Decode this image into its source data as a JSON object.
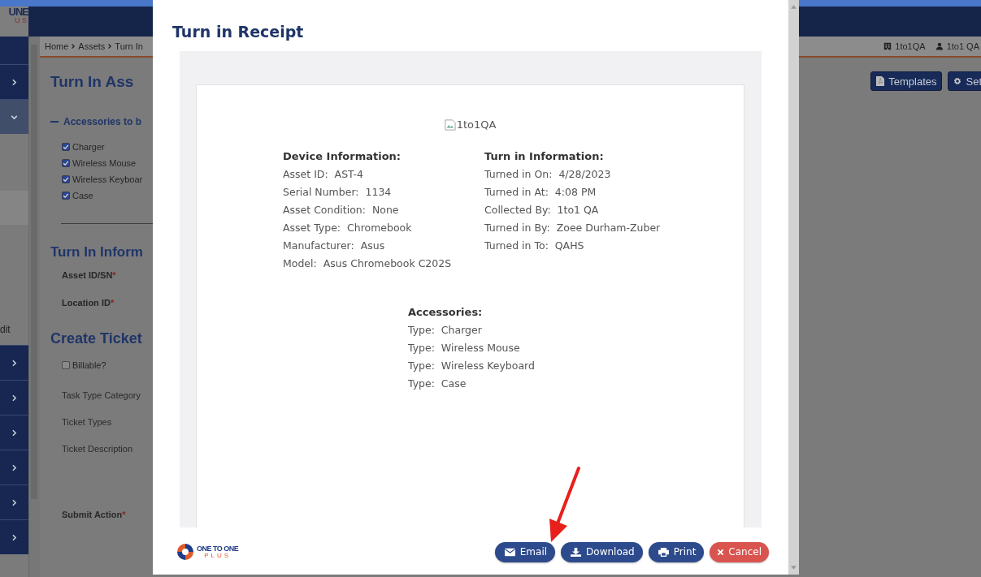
{
  "logo": {
    "text": "UNE",
    "subtext": "U S"
  },
  "sidebar": {
    "items": [
      {
        "expanded": false
      },
      {
        "expanded": true
      }
    ],
    "label": "dit",
    "lower_items": [
      {
        "expanded": false
      },
      {
        "expanded": false
      },
      {
        "expanded": false
      },
      {
        "expanded": false
      },
      {
        "expanded": false
      },
      {
        "expanded": false
      }
    ]
  },
  "breadcrumb": [
    "Home",
    "Assets",
    "Turn In"
  ],
  "account": {
    "site": "1to1QA",
    "user": "1to1 QA"
  },
  "toolbar": [
    {
      "label": "Templates",
      "kind": "templates"
    },
    {
      "label": "Set",
      "kind": "settings"
    }
  ],
  "page": {
    "title": "Turn In Ass",
    "accessories_heading": "Accessories to b",
    "accessories": [
      {
        "label": "Charger",
        "checked": true
      },
      {
        "label": "Wireless Mouse",
        "checked": true
      },
      {
        "label": "Wireless Keyboar",
        "checked": true
      },
      {
        "label": "Case",
        "checked": true
      }
    ],
    "turn_in_heading": "Turn In Inform",
    "fields": [
      {
        "label": "Asset ID/SN",
        "required_mark": "*"
      },
      {
        "label": "Location ID",
        "required_mark": "*"
      }
    ],
    "ticket_heading": "Create Ticket",
    "billable": {
      "label": "Billable?",
      "checked": false
    },
    "ticket_fields": [
      {
        "label": "Task Type Category"
      },
      {
        "label": "Ticket Types"
      },
      {
        "label": "Ticket Description"
      },
      {
        "label": "Submit Action",
        "required_mark": "*"
      }
    ]
  },
  "modal": {
    "title": "Turn in Receipt",
    "logo_alt": "1to1QA",
    "device": {
      "heading": "Device Information:",
      "rows": [
        "Asset ID:  AST-4",
        "Serial Number:  1134",
        "Asset Condition:  None",
        "Asset Type:  Chromebook",
        "Manufacturer:  Asus",
        "Model:  Asus Chromebook C202S"
      ]
    },
    "turn_in": {
      "heading": "Turn in Information:",
      "rows": [
        "Turned in On:  4/28/2023",
        "Turned in At:  4:08 PM",
        "Collected By:  1to1 QA",
        "Turned in By:  Zoee Durham-Zuber",
        "Turned in To:  QAHS"
      ]
    },
    "accessories": {
      "heading": "Accessories:",
      "rows": [
        "Type:  Charger",
        "Type:  Wireless Mouse",
        "Type:  Wireless Keyboard",
        "Type:  Case"
      ]
    },
    "brand": {
      "name": "ONE TO ONE",
      "sub": "PLUS"
    },
    "buttons": [
      {
        "label": "Email",
        "kind": "email"
      },
      {
        "label": "Download",
        "kind": "download"
      },
      {
        "label": "Print",
        "kind": "print"
      },
      {
        "label": "Cancel",
        "kind": "cancel"
      }
    ]
  }
}
